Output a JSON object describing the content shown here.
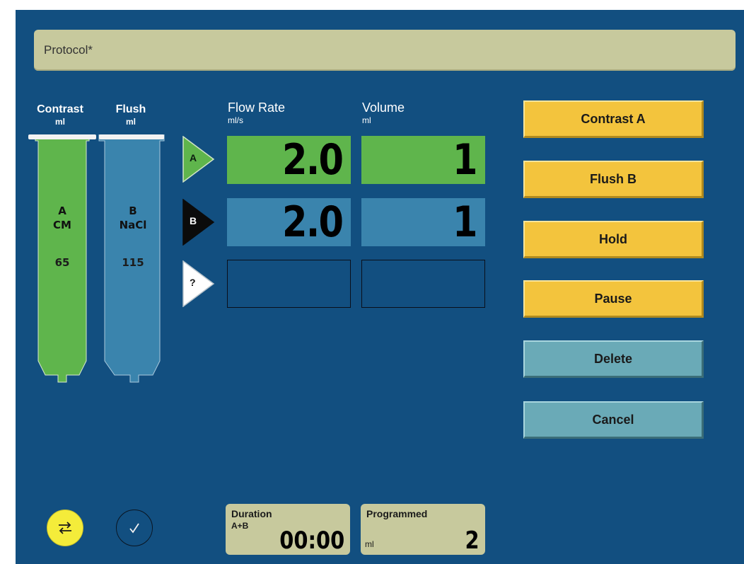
{
  "protocol": {
    "title": "Protocol*"
  },
  "syringes": {
    "contrast": {
      "header": "Contrast",
      "unit": "ml",
      "letter": "A",
      "agent": "CM",
      "remaining": "65",
      "color": "#5fb54c"
    },
    "flush": {
      "header": "Flush",
      "unit": "ml",
      "letter": "B",
      "agent": "NaCl",
      "remaining": "115",
      "color": "#3a84ad"
    }
  },
  "table": {
    "flow_rate_header": "Flow Rate",
    "flow_rate_unit": "ml/s",
    "volume_header": "Volume",
    "volume_unit": "ml",
    "phases": [
      {
        "marker": "A",
        "flow_rate": "2.0",
        "volume": "1"
      },
      {
        "marker": "B",
        "flow_rate": "2.0",
        "volume": "1"
      },
      {
        "marker": "?",
        "flow_rate": "",
        "volume": ""
      }
    ]
  },
  "buttons": {
    "contrast_a": "Contrast A",
    "flush_b": "Flush B",
    "hold": "Hold",
    "pause": "Pause",
    "delete": "Delete",
    "cancel": "Cancel"
  },
  "icons": {
    "swap": "swap-arrows-icon",
    "confirm": "checkmark-icon"
  },
  "duration": {
    "label": "Duration",
    "sub": "A+B",
    "value": "00:00"
  },
  "programmed": {
    "label": "Programmed",
    "unit": "ml",
    "value": "2"
  },
  "colors": {
    "background": "#124f80",
    "panel": "#c7c99d",
    "button_primary": "#f3c43d",
    "button_secondary": "#6aaab7",
    "contrast": "#5fb54c",
    "flush": "#3a84ad"
  }
}
